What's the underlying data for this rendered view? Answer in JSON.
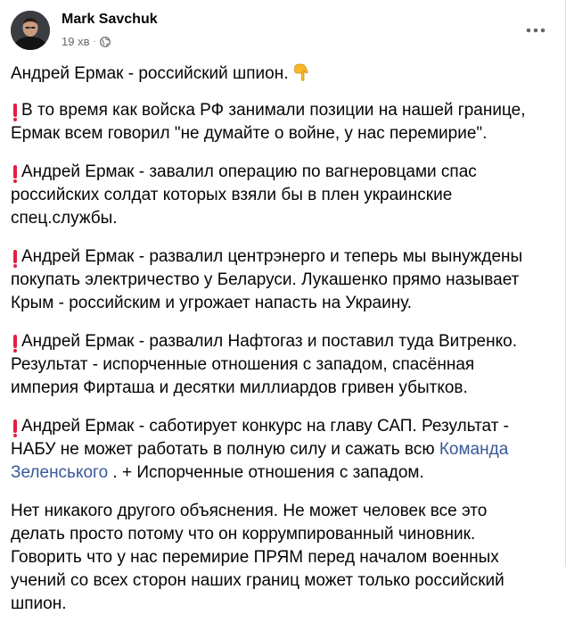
{
  "post": {
    "author": "Mark Savchuk",
    "time": "19 хв",
    "separator": "·",
    "privacy_icon": "globe-icon",
    "more_icon": "more-horizontal-icon",
    "lead_text": "Андрей Ермак - российский шпион.",
    "lead_icon": "pointing-down-hand-icon",
    "paragraphs": [
      {
        "text": "В то время как войска РФ занимали позиции на нашей границе, Ермак всем говорил \"не думайте о войне, у нас перемирие\"."
      },
      {
        "text": "Андрей Ермак - завалил операцию по вагнеровцами спас российских солдат которых взяли бы в плен украинские спец.службы."
      },
      {
        "text": "Андрей Ермак - развалил центрэнерго и теперь мы вынуждены покупать электричество у Беларуси. Лукашенко прямо называет Крым - российским и угрожает напасть на Украину."
      },
      {
        "text": "Андрей Ермак - развалил Нафтогаз и поставил туда Витренко. Результат - испорченные отношения с западом, спасённая империя Фирташа и десятки миллиардов гривен убытков."
      },
      {
        "text_before": "Андрей Ермак - саботирует конкурс на главу САП. Результат - НАБУ не может работать в полную силу и сажать всю",
        "link": "Команда Зеленського",
        "text_after": ". + Испорченные отношения с западом."
      }
    ],
    "closing": "Нет никакого другого объяснения. Не может человек все это делать просто потому что он коррумпированный чиновник. Говорить что у нас перемирие ПРЯМ перед началом военных учений со всех сторон наших границ может только российский шпион.",
    "accent_color": "#385898",
    "exclamation_color": "#e41e3f"
  }
}
